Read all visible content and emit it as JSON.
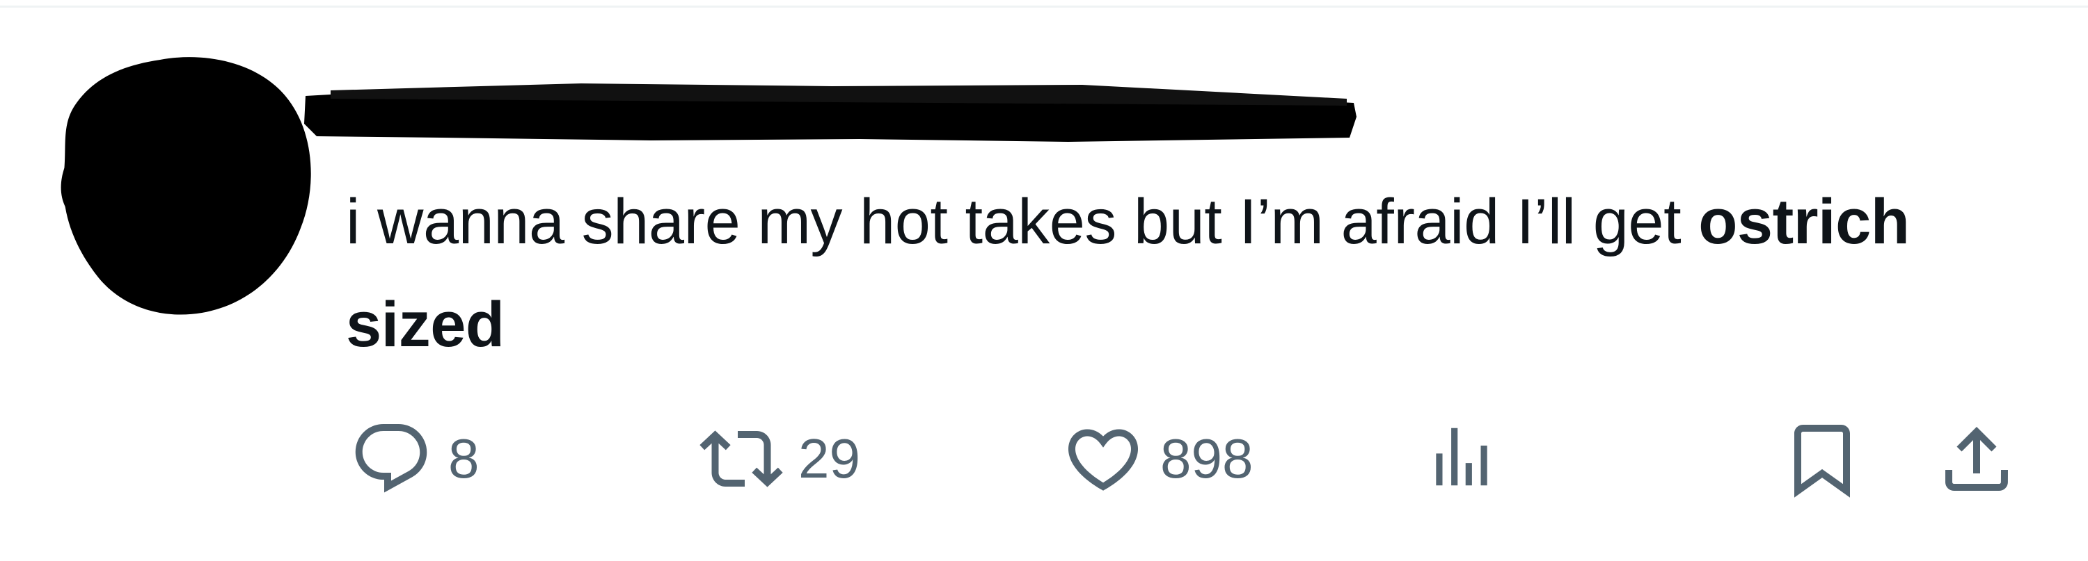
{
  "tweet": {
    "text_regular": "i wanna share my hot takes but I’m afraid I’ll get ",
    "text_bold": "ostrich sized"
  },
  "actions": {
    "reply": {
      "icon": "speech-bubble-icon",
      "count": "8"
    },
    "repost": {
      "icon": "repost-arrows-icon",
      "count": "29"
    },
    "like": {
      "icon": "heart-icon",
      "count": "898"
    },
    "views": {
      "icon": "bar-chart-icon"
    },
    "bookmark": {
      "icon": "bookmark-icon"
    },
    "share": {
      "icon": "share-upload-icon"
    }
  },
  "colors": {
    "text": "#0f1419",
    "secondary": "#536471",
    "divider": "#eff3f4",
    "redaction": "#000000"
  }
}
